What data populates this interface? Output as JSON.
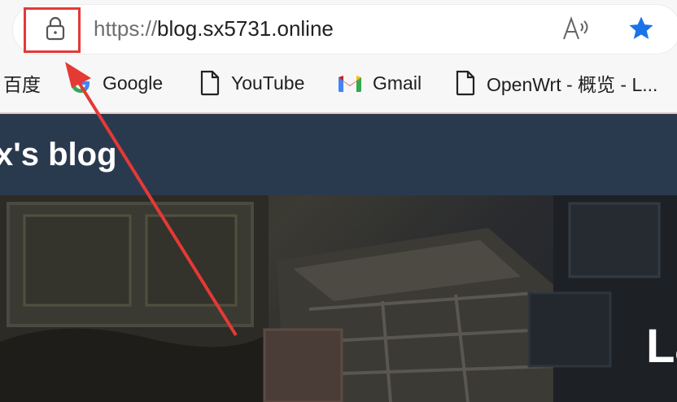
{
  "browser": {
    "url_scheme": "https://",
    "url_host": "blog.sx5731.online",
    "icons": {
      "lock": "lock-icon",
      "read_aloud": "read-aloud-icon",
      "favorite": "star-icon"
    },
    "colors": {
      "favorite_star": "#1a73e8",
      "highlight": "#e53935"
    }
  },
  "bookmarks": [
    {
      "label": "百度",
      "icon": "none"
    },
    {
      "label": "Google",
      "icon": "google-icon"
    },
    {
      "label": "YouTube",
      "icon": "page-icon"
    },
    {
      "label": "Gmail",
      "icon": "gmail-icon"
    },
    {
      "label": "OpenWrt - 概览 - L...",
      "icon": "page-icon"
    }
  ],
  "blog": {
    "title": "x's blog",
    "hero_text": "La",
    "header_color": "#2a3a4e"
  }
}
